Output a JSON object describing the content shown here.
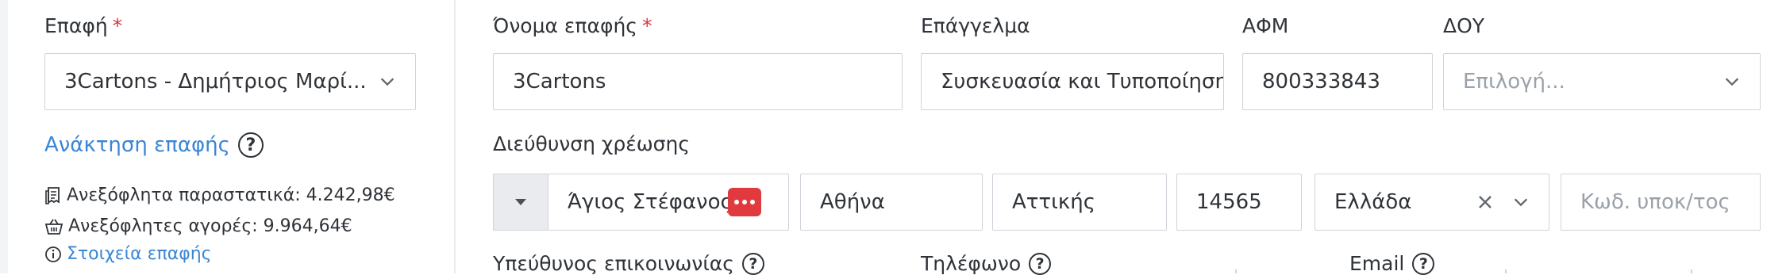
{
  "contact": {
    "label": "Επαφή",
    "required_mark": "*",
    "selected": "3Cartons - Δημήτριος Μαρί...",
    "retrieve_link": "Ανάκτηση επαφής",
    "help_glyph": "?",
    "stats": {
      "unpaid_docs": "Ανεξόφλητα παραστατικά: 4.242,98€",
      "unpaid_purchases": "Ανεξόφλητες αγορές: 9.964,64€",
      "details_link": "Στοιχεία επαφής"
    }
  },
  "form": {
    "name": {
      "label": "Όνομα επαφής",
      "required_mark": "*",
      "value": "3Cartons"
    },
    "profession": {
      "label": "Επάγγελμα",
      "value": "Συσκευασία και Τυποποίηση"
    },
    "afm": {
      "label": "ΑΦΜ",
      "value": "800333843"
    },
    "doy": {
      "label": "ΔΟΥ",
      "placeholder": "Επιλογή..."
    },
    "billing": {
      "label": "Διεύθυνση χρέωσης",
      "street": "Άγιος Στέφανος",
      "city": "Αθήνα",
      "region": "Αττικής",
      "zip": "14565",
      "country": "Ελλάδα",
      "subcode_placeholder": "Κωδ. υποκ/τος"
    },
    "next_row": {
      "contact_person": "Υπεύθυνος επικοινωνίας",
      "phone": "Τηλέφωνο",
      "email": "Email"
    }
  },
  "colors": {
    "accent": "#3a86d4",
    "required": "#d9363e",
    "badge": "#e0393e",
    "border": "#cfd4da"
  },
  "icons": {
    "dropdown": "chevron-down-icon",
    "clear": "close-icon",
    "badge": "password-dots-icon"
  }
}
